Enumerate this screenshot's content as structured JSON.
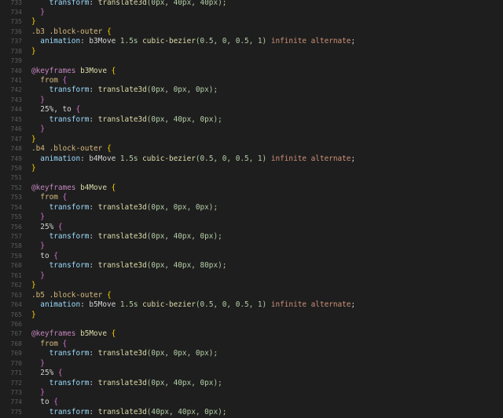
{
  "editor": {
    "lines": [
      {
        "n": "733",
        "indent": "    ",
        "tokens": [
          {
            "t": "transform",
            "c": "prop"
          },
          {
            "t": ": ",
            "c": "plain"
          },
          {
            "t": "translate3d",
            "c": "fn"
          },
          {
            "t": "(0px, 40px, 40px);",
            "c": "num"
          }
        ]
      },
      {
        "n": "734",
        "indent": "  ",
        "tokens": [
          {
            "t": "}",
            "c": "brace2"
          }
        ]
      },
      {
        "n": "735",
        "indent": "",
        "tokens": [
          {
            "t": "}",
            "c": "brace"
          }
        ]
      },
      {
        "n": "736",
        "indent": "",
        "tokens": [
          {
            "t": ".b3 .block-outer ",
            "c": "sel"
          },
          {
            "t": "{",
            "c": "brace"
          }
        ]
      },
      {
        "n": "737",
        "indent": "  ",
        "tokens": [
          {
            "t": "animation",
            "c": "prop"
          },
          {
            "t": ": b3Move ",
            "c": "plain"
          },
          {
            "t": "1.5s ",
            "c": "num"
          },
          {
            "t": "cubic-bezier",
            "c": "fn"
          },
          {
            "t": "(0.5, 0, 0.5, 1) ",
            "c": "num"
          },
          {
            "t": "infinite alternate",
            "c": "kw"
          },
          {
            "t": ";",
            "c": "plain"
          }
        ]
      },
      {
        "n": "738",
        "indent": "",
        "tokens": [
          {
            "t": "}",
            "c": "brace"
          }
        ]
      },
      {
        "n": "739",
        "indent": "",
        "tokens": []
      },
      {
        "n": "740",
        "indent": "",
        "tokens": [
          {
            "t": "@keyframes ",
            "c": "at"
          },
          {
            "t": "b3Move ",
            "c": "kf"
          },
          {
            "t": "{",
            "c": "brace"
          }
        ]
      },
      {
        "n": "741",
        "indent": "  ",
        "tokens": [
          {
            "t": "from ",
            "c": "sel"
          },
          {
            "t": "{",
            "c": "brace2"
          }
        ]
      },
      {
        "n": "742",
        "indent": "    ",
        "tokens": [
          {
            "t": "transform",
            "c": "prop"
          },
          {
            "t": ": ",
            "c": "plain"
          },
          {
            "t": "translate3d",
            "c": "fn"
          },
          {
            "t": "(0px, 0px, 0px);",
            "c": "num"
          }
        ]
      },
      {
        "n": "743",
        "indent": "  ",
        "tokens": [
          {
            "t": "}",
            "c": "brace2"
          }
        ]
      },
      {
        "n": "744",
        "indent": "  ",
        "tokens": [
          {
            "t": "25%, to ",
            "c": "plain"
          },
          {
            "t": "{",
            "c": "brace2"
          }
        ]
      },
      {
        "n": "745",
        "indent": "    ",
        "tokens": [
          {
            "t": "transform",
            "c": "prop"
          },
          {
            "t": ": ",
            "c": "plain"
          },
          {
            "t": "translate3d",
            "c": "fn"
          },
          {
            "t": "(0px, 40px, 0px);",
            "c": "num"
          }
        ]
      },
      {
        "n": "746",
        "indent": "  ",
        "tokens": [
          {
            "t": "}",
            "c": "brace2"
          }
        ]
      },
      {
        "n": "747",
        "indent": "",
        "tokens": [
          {
            "t": "}",
            "c": "brace"
          }
        ]
      },
      {
        "n": "748",
        "indent": "",
        "tokens": [
          {
            "t": ".b4 .block-outer ",
            "c": "sel"
          },
          {
            "t": "{",
            "c": "brace"
          }
        ]
      },
      {
        "n": "749",
        "indent": "  ",
        "tokens": [
          {
            "t": "animation",
            "c": "prop"
          },
          {
            "t": ": b4Move ",
            "c": "plain"
          },
          {
            "t": "1.5s ",
            "c": "num"
          },
          {
            "t": "cubic-bezier",
            "c": "fn"
          },
          {
            "t": "(0.5, 0, 0.5, 1) ",
            "c": "num"
          },
          {
            "t": "infinite alternate",
            "c": "kw"
          },
          {
            "t": ";",
            "c": "plain"
          }
        ]
      },
      {
        "n": "750",
        "indent": "",
        "tokens": [
          {
            "t": "}",
            "c": "brace"
          }
        ]
      },
      {
        "n": "751",
        "indent": "",
        "tokens": []
      },
      {
        "n": "752",
        "indent": "",
        "tokens": [
          {
            "t": "@keyframes ",
            "c": "at"
          },
          {
            "t": "b4Move ",
            "c": "kf"
          },
          {
            "t": "{",
            "c": "brace"
          }
        ]
      },
      {
        "n": "753",
        "indent": "  ",
        "tokens": [
          {
            "t": "from ",
            "c": "sel"
          },
          {
            "t": "{",
            "c": "brace2"
          }
        ]
      },
      {
        "n": "754",
        "indent": "    ",
        "tokens": [
          {
            "t": "transform",
            "c": "prop"
          },
          {
            "t": ": ",
            "c": "plain"
          },
          {
            "t": "translate3d",
            "c": "fn"
          },
          {
            "t": "(0px, 0px, 0px);",
            "c": "num"
          }
        ]
      },
      {
        "n": "755",
        "indent": "  ",
        "tokens": [
          {
            "t": "}",
            "c": "brace2"
          }
        ]
      },
      {
        "n": "756",
        "indent": "  ",
        "tokens": [
          {
            "t": "25% ",
            "c": "plain"
          },
          {
            "t": "{",
            "c": "brace2"
          }
        ]
      },
      {
        "n": "757",
        "indent": "    ",
        "tokens": [
          {
            "t": "transform",
            "c": "prop"
          },
          {
            "t": ": ",
            "c": "plain"
          },
          {
            "t": "translate3d",
            "c": "fn"
          },
          {
            "t": "(0px, 40px, 0px);",
            "c": "num"
          }
        ]
      },
      {
        "n": "758",
        "indent": "  ",
        "tokens": [
          {
            "t": "}",
            "c": "brace2"
          }
        ]
      },
      {
        "n": "759",
        "indent": "  ",
        "tokens": [
          {
            "t": "to ",
            "c": "plain"
          },
          {
            "t": "{",
            "c": "brace2"
          }
        ]
      },
      {
        "n": "760",
        "indent": "    ",
        "tokens": [
          {
            "t": "transform",
            "c": "prop"
          },
          {
            "t": ": ",
            "c": "plain"
          },
          {
            "t": "translate3d",
            "c": "fn"
          },
          {
            "t": "(0px, 40px, 80px);",
            "c": "num"
          }
        ]
      },
      {
        "n": "761",
        "indent": "  ",
        "tokens": [
          {
            "t": "}",
            "c": "brace2"
          }
        ]
      },
      {
        "n": "762",
        "indent": "",
        "tokens": [
          {
            "t": "}",
            "c": "brace"
          }
        ]
      },
      {
        "n": "763",
        "indent": "",
        "tokens": [
          {
            "t": ".b5 .block-outer ",
            "c": "sel"
          },
          {
            "t": "{",
            "c": "brace"
          }
        ]
      },
      {
        "n": "764",
        "indent": "  ",
        "tokens": [
          {
            "t": "animation",
            "c": "prop"
          },
          {
            "t": ": b5Move ",
            "c": "plain"
          },
          {
            "t": "1.5s ",
            "c": "num"
          },
          {
            "t": "cubic-bezier",
            "c": "fn"
          },
          {
            "t": "(0.5, 0, 0.5, 1) ",
            "c": "num"
          },
          {
            "t": "infinite alternate",
            "c": "kw"
          },
          {
            "t": ";",
            "c": "plain"
          }
        ]
      },
      {
        "n": "765",
        "indent": "",
        "tokens": [
          {
            "t": "}",
            "c": "brace"
          }
        ]
      },
      {
        "n": "766",
        "indent": "",
        "tokens": []
      },
      {
        "n": "767",
        "indent": "",
        "tokens": [
          {
            "t": "@keyframes ",
            "c": "at"
          },
          {
            "t": "b5Move ",
            "c": "kf"
          },
          {
            "t": "{",
            "c": "brace"
          }
        ]
      },
      {
        "n": "768",
        "indent": "  ",
        "tokens": [
          {
            "t": "from ",
            "c": "sel"
          },
          {
            "t": "{",
            "c": "brace2"
          }
        ]
      },
      {
        "n": "769",
        "indent": "    ",
        "tokens": [
          {
            "t": "transform",
            "c": "prop"
          },
          {
            "t": ": ",
            "c": "plain"
          },
          {
            "t": "translate3d",
            "c": "fn"
          },
          {
            "t": "(0px, 0px, 0px);",
            "c": "num"
          }
        ]
      },
      {
        "n": "770",
        "indent": "  ",
        "tokens": [
          {
            "t": "}",
            "c": "brace2"
          }
        ]
      },
      {
        "n": "771",
        "indent": "  ",
        "tokens": [
          {
            "t": "25% ",
            "c": "plain"
          },
          {
            "t": "{",
            "c": "brace2"
          }
        ]
      },
      {
        "n": "772",
        "indent": "    ",
        "tokens": [
          {
            "t": "transform",
            "c": "prop"
          },
          {
            "t": ": ",
            "c": "plain"
          },
          {
            "t": "translate3d",
            "c": "fn"
          },
          {
            "t": "(0px, 40px, 0px);",
            "c": "num"
          }
        ]
      },
      {
        "n": "773",
        "indent": "  ",
        "tokens": [
          {
            "t": "}",
            "c": "brace2"
          }
        ]
      },
      {
        "n": "774",
        "indent": "  ",
        "tokens": [
          {
            "t": "to ",
            "c": "plain"
          },
          {
            "t": "{",
            "c": "brace2"
          }
        ]
      },
      {
        "n": "775",
        "indent": "    ",
        "tokens": [
          {
            "t": "transform",
            "c": "prop"
          },
          {
            "t": ": ",
            "c": "plain"
          },
          {
            "t": "translate3d",
            "c": "fn"
          },
          {
            "t": "(40px, 40px, 0px);",
            "c": "num"
          }
        ]
      }
    ]
  },
  "colors": {
    "background": "#1e1e1e",
    "line_number": "#5a5a5a",
    "property": "#9cdcfe",
    "selector": "#d7ba7d",
    "at_rule": "#c586c0",
    "function": "#dcdcaa",
    "keyword_value": "#ce9178",
    "brace_outer": "#ffd700",
    "brace_inner": "#da70d6"
  }
}
